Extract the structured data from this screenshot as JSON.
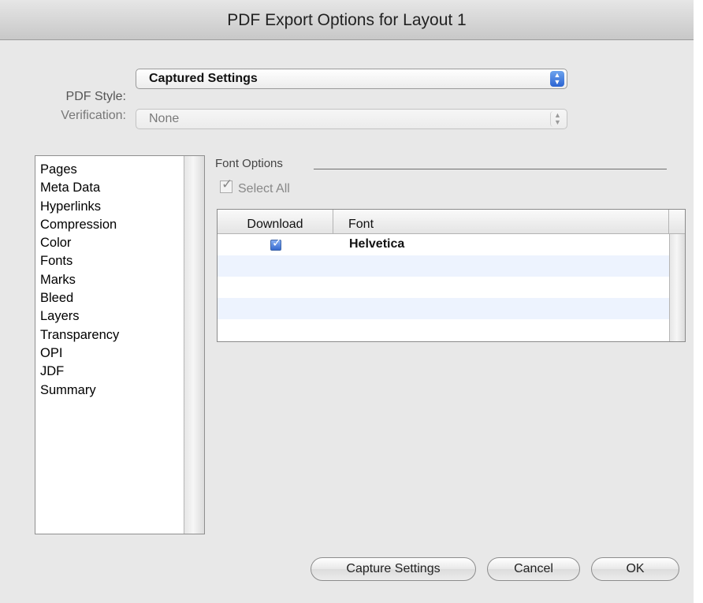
{
  "window": {
    "title": "PDF Export Options for Layout 1"
  },
  "pdf_style": {
    "label": "PDF Style:",
    "value": "Captured Settings",
    "icon": "popup-arrows-icon"
  },
  "verification": {
    "label": "Verification:",
    "value": "None",
    "icon": "popup-arrows-icon"
  },
  "sidebar": {
    "items": [
      {
        "label": "Pages"
      },
      {
        "label": "Meta Data"
      },
      {
        "label": "Hyperlinks"
      },
      {
        "label": "Compression"
      },
      {
        "label": "Color"
      },
      {
        "label": "Fonts"
      },
      {
        "label": "Marks"
      },
      {
        "label": "Bleed"
      },
      {
        "label": "Layers"
      },
      {
        "label": "Transparency"
      },
      {
        "label": "OPI"
      },
      {
        "label": "JDF"
      },
      {
        "label": "Summary"
      }
    ]
  },
  "font_options": {
    "group_title": "Font Options",
    "select_all_label": "Select All",
    "select_all_checked": true,
    "columns": {
      "download": "Download",
      "font": "Font"
    },
    "rows": [
      {
        "download_checked": true,
        "font": "Helvetica"
      }
    ]
  },
  "buttons": {
    "capture": "Capture Settings",
    "cancel": "Cancel",
    "ok": "OK"
  },
  "colors": {
    "dialog_bg": "#e8e8e8",
    "accent_blue": "#2a63d2",
    "alt_row": "#edf3fe"
  }
}
